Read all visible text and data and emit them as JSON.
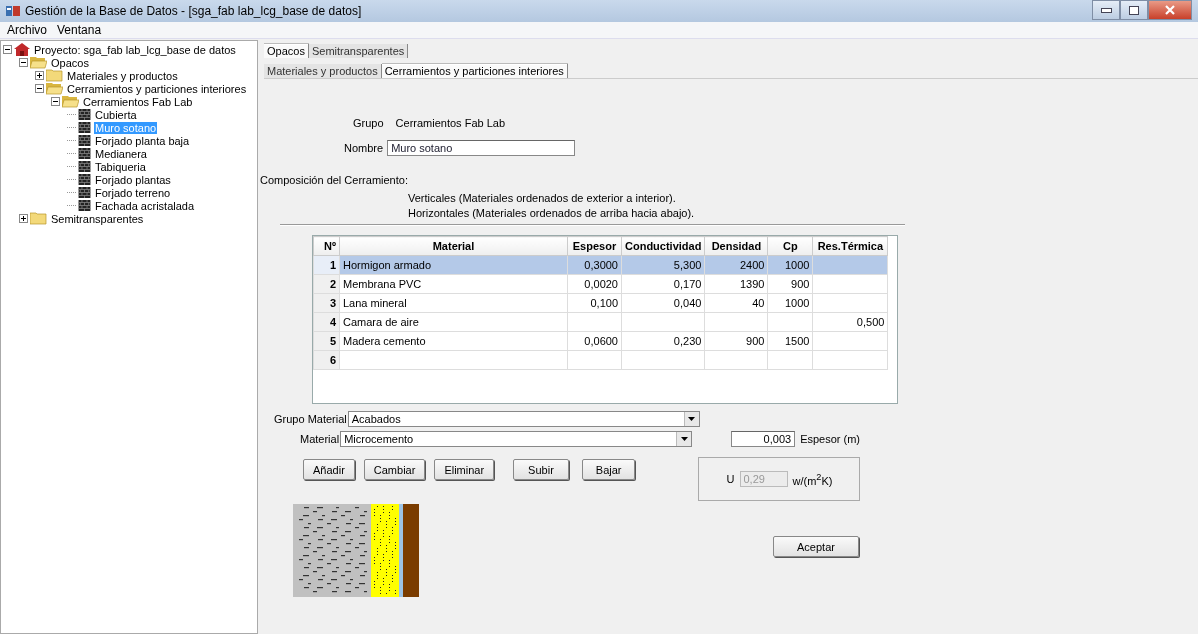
{
  "window": {
    "title": "Gestión de la Base de Datos - [sga_fab lab_lcg_base de datos]"
  },
  "menu": [
    "Archivo",
    "Ventana"
  ],
  "tree": [
    {
      "label": "Proyecto: sga_fab lab_lcg_base de datos",
      "kind": "project",
      "expanded": true,
      "selected": false,
      "children": [
        {
          "label": "Opacos",
          "kind": "folder",
          "expanded": true,
          "selected": false,
          "children": [
            {
              "label": "Materiales y productos",
              "kind": "folder",
              "expanded": false,
              "selected": false
            },
            {
              "label": "Cerramientos y particiones interiores",
              "kind": "folder",
              "expanded": true,
              "selected": false,
              "children": [
                {
                  "label": "Cerramientos Fab Lab",
                  "kind": "folder",
                  "expanded": true,
                  "selected": false,
                  "children": [
                    {
                      "label": "Cubierta",
                      "kind": "element",
                      "selected": false
                    },
                    {
                      "label": "Muro sotano",
                      "kind": "element",
                      "selected": true
                    },
                    {
                      "label": "Forjado planta baja",
                      "kind": "element",
                      "selected": false
                    },
                    {
                      "label": "Medianera",
                      "kind": "element",
                      "selected": false
                    },
                    {
                      "label": "Tabiqueria",
                      "kind": "element",
                      "selected": false
                    },
                    {
                      "label": "Forjado plantas",
                      "kind": "element",
                      "selected": false
                    },
                    {
                      "label": "Forjado terreno",
                      "kind": "element",
                      "selected": false
                    },
                    {
                      "label": "Fachada acristalada",
                      "kind": "element",
                      "selected": false
                    }
                  ]
                }
              ]
            }
          ]
        },
        {
          "label": "Semitransparentes",
          "kind": "folder",
          "expanded": false,
          "selected": false
        }
      ]
    }
  ],
  "tabs": [
    {
      "label": "Opacos",
      "selected": true
    },
    {
      "label": "Semitransparentes",
      "selected": false
    }
  ],
  "subtabs": [
    {
      "label": "Materiales y productos",
      "selected": false
    },
    {
      "label": "Cerramientos y particiones interiores",
      "selected": true
    }
  ],
  "grupo": {
    "label": "Grupo",
    "value": "Cerramientos Fab Lab"
  },
  "nombre": {
    "label": "Nombre",
    "value": "Muro sotano"
  },
  "composicion": {
    "title": "Composición del Cerramiento:",
    "notes": [
      "Verticales (Materiales ordenados de exterior a interior).",
      "Horizontales (Materiales ordenados de arriba hacia abajo)."
    ]
  },
  "table": {
    "columns": [
      "Nº",
      "Material",
      "Espesor",
      "Conductividad",
      "Densidad",
      "Cp",
      "Res.Térmica"
    ],
    "rows": [
      {
        "cells": [
          "1",
          "Hormigon armado",
          "0,3000",
          "5,300",
          "2400",
          "1000",
          null
        ],
        "selected": true
      },
      {
        "cells": [
          "2",
          "Membrana PVC",
          "0,0020",
          "0,170",
          "1390",
          "900",
          null
        ],
        "selected": false
      },
      {
        "cells": [
          "3",
          "Lana mineral",
          "0,100",
          "0,040",
          "40",
          "1000",
          null
        ],
        "selected": false
      },
      {
        "cells": [
          "4",
          "Camara de aire",
          null,
          null,
          null,
          null,
          "0,500"
        ],
        "selected": false
      },
      {
        "cells": [
          "5",
          "Madera cemento",
          "0,0600",
          "0,230",
          "900",
          "1500",
          null
        ],
        "selected": false
      },
      {
        "cells": [
          "6",
          null,
          null,
          null,
          null,
          null,
          null
        ],
        "selected": false
      }
    ]
  },
  "grupo_material": {
    "label": "Grupo Material",
    "value": "Acabados"
  },
  "material": {
    "label": "Material",
    "value": "Microcemento"
  },
  "espesor": {
    "value": "0,003",
    "label": "Espesor (m)"
  },
  "buttons": [
    "Añadir",
    "Cambiar",
    "Eliminar",
    "Subir",
    "Bajar"
  ],
  "u_value": {
    "label": "U",
    "value": "0,29",
    "unit": "w/(m$^{2}$K)",
    "disabled": true
  },
  "accept_button": "Aceptar"
}
